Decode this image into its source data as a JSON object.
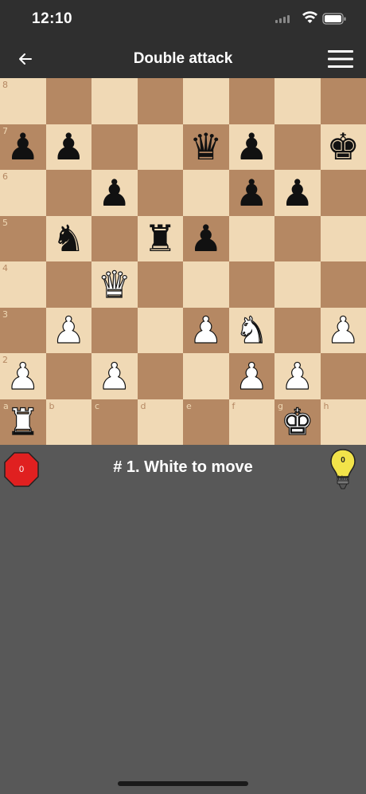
{
  "status_bar": {
    "time": "12:10"
  },
  "nav": {
    "title": "Double attack",
    "back_icon": "arrow-left-icon",
    "menu_icon": "hamburger-menu-icon"
  },
  "board": {
    "files": [
      "a",
      "b",
      "c",
      "d",
      "e",
      "f",
      "g",
      "h"
    ],
    "ranks": [
      "8",
      "7",
      "6",
      "5",
      "4",
      "3",
      "2",
      "1"
    ],
    "colors": {
      "light": "#f0d9b5",
      "dark": "#b58863"
    },
    "pieces": [
      {
        "square": "a7",
        "piece": "pawn",
        "color": "black"
      },
      {
        "square": "b7",
        "piece": "pawn",
        "color": "black"
      },
      {
        "square": "e7",
        "piece": "queen",
        "color": "black"
      },
      {
        "square": "f7",
        "piece": "pawn",
        "color": "black"
      },
      {
        "square": "h7",
        "piece": "king",
        "color": "black"
      },
      {
        "square": "c6",
        "piece": "pawn",
        "color": "black"
      },
      {
        "square": "f6",
        "piece": "pawn",
        "color": "black"
      },
      {
        "square": "g6",
        "piece": "pawn",
        "color": "black"
      },
      {
        "square": "b5",
        "piece": "knight",
        "color": "black"
      },
      {
        "square": "d5",
        "piece": "rook",
        "color": "black"
      },
      {
        "square": "e5",
        "piece": "pawn",
        "color": "black"
      },
      {
        "square": "c4",
        "piece": "queen",
        "color": "white"
      },
      {
        "square": "b3",
        "piece": "pawn",
        "color": "white"
      },
      {
        "square": "e3",
        "piece": "pawn",
        "color": "white"
      },
      {
        "square": "f3",
        "piece": "knight",
        "color": "white"
      },
      {
        "square": "h3",
        "piece": "pawn",
        "color": "white"
      },
      {
        "square": "a2",
        "piece": "pawn",
        "color": "white"
      },
      {
        "square": "c2",
        "piece": "pawn",
        "color": "white"
      },
      {
        "square": "f2",
        "piece": "pawn",
        "color": "white"
      },
      {
        "square": "g2",
        "piece": "pawn",
        "color": "white"
      },
      {
        "square": "a1",
        "piece": "rook",
        "color": "white"
      },
      {
        "square": "g1",
        "piece": "king",
        "color": "white"
      }
    ]
  },
  "info": {
    "error_count": "0",
    "error_color": "#e02020",
    "status": "# 1. White to move",
    "hint_count": "0",
    "hint_label": "hint",
    "hint_color": "#f2e34a"
  }
}
